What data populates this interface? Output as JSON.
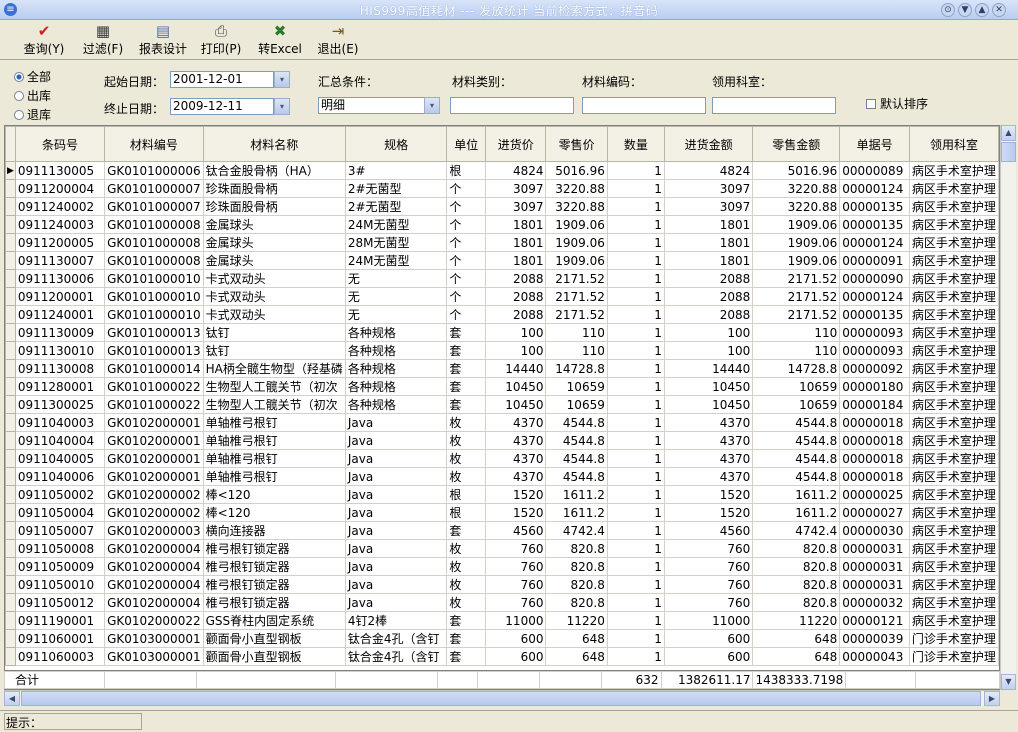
{
  "window": {
    "title": "HIS999高值耗材 --- 发放统计      当前检索方式：拼音码",
    "buttons": [
      "⊙",
      "▼",
      "▲",
      "✕"
    ]
  },
  "toolbar": {
    "query": "查询(Y)",
    "filter": "过滤(F)",
    "report_design": "报表设计",
    "print": "打印(P)",
    "excel": "转Excel",
    "exit": "退出(E)"
  },
  "filter": {
    "radio_all": "全部",
    "radio_out": "出库",
    "radio_return": "退库",
    "start_label": "起始日期：",
    "start_value": "2001-12-01",
    "end_label": "终止日期：",
    "end_value": "2009-12-11",
    "summary_label": "汇总条件：",
    "summary_value": "明细",
    "category_label": "材料类别：",
    "code_label": "材料编码：",
    "dept_label": "领用科室：",
    "default_sort": "默认排序"
  },
  "table": {
    "columns": [
      "条码号",
      "材料编号",
      "材料名称",
      "规格",
      "单位",
      "进货价",
      "零售价",
      "数量",
      "进货金额",
      "零售金额",
      "单据号",
      "领用科室"
    ],
    "rows": [
      [
        "0911130005",
        "GK0101000006",
        "钛合金股骨柄（HA）",
        "3#",
        "根",
        "4824",
        "5016.96",
        "1",
        "4824",
        "5016.96",
        "00000089",
        "病区手术室护理"
      ],
      [
        "0911200004",
        "GK0101000007",
        "珍珠面股骨柄",
        "2#无菌型",
        "个",
        "3097",
        "3220.88",
        "1",
        "3097",
        "3220.88",
        "00000124",
        "病区手术室护理"
      ],
      [
        "0911240002",
        "GK0101000007",
        "珍珠面股骨柄",
        "2#无菌型",
        "个",
        "3097",
        "3220.88",
        "1",
        "3097",
        "3220.88",
        "00000135",
        "病区手术室护理"
      ],
      [
        "0911240003",
        "GK0101000008",
        "金属球头",
        "24M无菌型",
        "个",
        "1801",
        "1909.06",
        "1",
        "1801",
        "1909.06",
        "00000135",
        "病区手术室护理"
      ],
      [
        "0911200005",
        "GK0101000008",
        "金属球头",
        "28M无菌型",
        "个",
        "1801",
        "1909.06",
        "1",
        "1801",
        "1909.06",
        "00000124",
        "病区手术室护理"
      ],
      [
        "0911130007",
        "GK0101000008",
        "金属球头",
        "24M无菌型",
        "个",
        "1801",
        "1909.06",
        "1",
        "1801",
        "1909.06",
        "00000091",
        "病区手术室护理"
      ],
      [
        "0911130006",
        "GK0101000010",
        "卡式双动头",
        "无",
        "个",
        "2088",
        "2171.52",
        "1",
        "2088",
        "2171.52",
        "00000090",
        "病区手术室护理"
      ],
      [
        "0911200001",
        "GK0101000010",
        "卡式双动头",
        "无",
        "个",
        "2088",
        "2171.52",
        "1",
        "2088",
        "2171.52",
        "00000124",
        "病区手术室护理"
      ],
      [
        "0911240001",
        "GK0101000010",
        "卡式双动头",
        "无",
        "个",
        "2088",
        "2171.52",
        "1",
        "2088",
        "2171.52",
        "00000135",
        "病区手术室护理"
      ],
      [
        "0911130009",
        "GK0101000013",
        "钛钉",
        "各种规格",
        "套",
        "100",
        "110",
        "1",
        "100",
        "110",
        "00000093",
        "病区手术室护理"
      ],
      [
        "0911130010",
        "GK0101000013",
        "钛钉",
        "各种规格",
        "套",
        "100",
        "110",
        "1",
        "100",
        "110",
        "00000093",
        "病区手术室护理"
      ],
      [
        "0911130008",
        "GK0101000014",
        "HA柄全髋生物型（羟基磷",
        "各种规格",
        "套",
        "14440",
        "14728.8",
        "1",
        "14440",
        "14728.8",
        "00000092",
        "病区手术室护理"
      ],
      [
        "0911280001",
        "GK0101000022",
        "生物型人工髋关节（初次",
        "各种规格",
        "套",
        "10450",
        "10659",
        "1",
        "10450",
        "10659",
        "00000180",
        "病区手术室护理"
      ],
      [
        "0911300025",
        "GK0101000022",
        "生物型人工髋关节（初次",
        "各种规格",
        "套",
        "10450",
        "10659",
        "1",
        "10450",
        "10659",
        "00000184",
        "病区手术室护理"
      ],
      [
        "0911040003",
        "GK0102000001",
        "单轴椎弓根钉",
        "Java",
        "枚",
        "4370",
        "4544.8",
        "1",
        "4370",
        "4544.8",
        "00000018",
        "病区手术室护理"
      ],
      [
        "0911040004",
        "GK0102000001",
        "单轴椎弓根钉",
        "Java",
        "枚",
        "4370",
        "4544.8",
        "1",
        "4370",
        "4544.8",
        "00000018",
        "病区手术室护理"
      ],
      [
        "0911040005",
        "GK0102000001",
        "单轴椎弓根钉",
        "Java",
        "枚",
        "4370",
        "4544.8",
        "1",
        "4370",
        "4544.8",
        "00000018",
        "病区手术室护理"
      ],
      [
        "0911040006",
        "GK0102000001",
        "单轴椎弓根钉",
        "Java",
        "枚",
        "4370",
        "4544.8",
        "1",
        "4370",
        "4544.8",
        "00000018",
        "病区手术室护理"
      ],
      [
        "0911050002",
        "GK0102000002",
        "棒<120",
        "Java",
        "根",
        "1520",
        "1611.2",
        "1",
        "1520",
        "1611.2",
        "00000025",
        "病区手术室护理"
      ],
      [
        "0911050004",
        "GK0102000002",
        "棒<120",
        "Java",
        "根",
        "1520",
        "1611.2",
        "1",
        "1520",
        "1611.2",
        "00000027",
        "病区手术室护理"
      ],
      [
        "0911050007",
        "GK0102000003",
        "横向连接器",
        "Java",
        "套",
        "4560",
        "4742.4",
        "1",
        "4560",
        "4742.4",
        "00000030",
        "病区手术室护理"
      ],
      [
        "0911050008",
        "GK0102000004",
        "椎弓根钉锁定器",
        "Java",
        "枚",
        "760",
        "820.8",
        "1",
        "760",
        "820.8",
        "00000031",
        "病区手术室护理"
      ],
      [
        "0911050009",
        "GK0102000004",
        "椎弓根钉锁定器",
        "Java",
        "枚",
        "760",
        "820.8",
        "1",
        "760",
        "820.8",
        "00000031",
        "病区手术室护理"
      ],
      [
        "0911050010",
        "GK0102000004",
        "椎弓根钉锁定器",
        "Java",
        "枚",
        "760",
        "820.8",
        "1",
        "760",
        "820.8",
        "00000031",
        "病区手术室护理"
      ],
      [
        "0911050012",
        "GK0102000004",
        "椎弓根钉锁定器",
        "Java",
        "枚",
        "760",
        "820.8",
        "1",
        "760",
        "820.8",
        "00000032",
        "病区手术室护理"
      ],
      [
        "0911190001",
        "GK0102000022",
        "GSS脊柱内固定系统",
        "4钉2棒",
        "套",
        "11000",
        "11220",
        "1",
        "11000",
        "11220",
        "00000121",
        "病区手术室护理"
      ],
      [
        "0911060001",
        "GK0103000001",
        "颧面骨小直型钢板",
        "钛合金4孔（含钉",
        "套",
        "600",
        "648",
        "1",
        "600",
        "648",
        "00000039",
        "门诊手术室护理"
      ],
      [
        "0911060003",
        "GK0103000001",
        "颧面骨小直型钢板",
        "钛合金4孔（含钉",
        "套",
        "600",
        "648",
        "1",
        "600",
        "648",
        "00000043",
        "门诊手术室护理"
      ]
    ],
    "totals": {
      "label": "合计",
      "qty": "632",
      "purchase_amount": "1382611.17",
      "retail_amount": "1438333.7198"
    }
  },
  "status": {
    "label": "提示："
  },
  "icons": {
    "app": "app-icon",
    "query": "checkmark-icon",
    "filter": "calculator-icon",
    "report": "report-icon",
    "print": "printer-icon",
    "excel": "excel-icon",
    "exit": "exit-door-icon"
  }
}
